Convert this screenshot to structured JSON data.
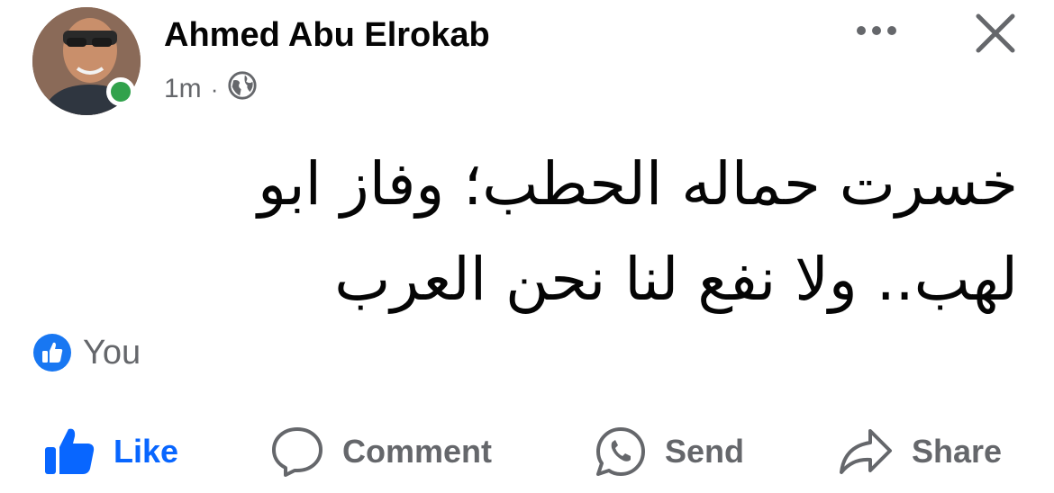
{
  "post": {
    "author": "Ahmed Abu Elrokab",
    "timestamp": "1m",
    "separator": "·",
    "audience_icon": "globe-icon",
    "text_line1": "خسرت حماله الحطب؛ وفاز ابو",
    "text_line2": "لهب.. ولا نفع لنا نحن العرب",
    "menu_icon": "more-icon",
    "close_icon": "close-icon"
  },
  "reactions": {
    "icon": "like-reaction-icon",
    "label": "You"
  },
  "actions": [
    {
      "label": "Like",
      "icon": "thumbs-up-icon",
      "color": "#0866ff"
    },
    {
      "label": "Comment",
      "icon": "comment-icon",
      "color": "#65676b"
    },
    {
      "label": "Send",
      "icon": "whatsapp-icon",
      "color": "#65676b"
    },
    {
      "label": "Share",
      "icon": "share-icon",
      "color": "#65676b"
    }
  ],
  "colors": {
    "online": "#31a24c",
    "secondary_text": "#65676b",
    "accent": "#0866ff"
  }
}
